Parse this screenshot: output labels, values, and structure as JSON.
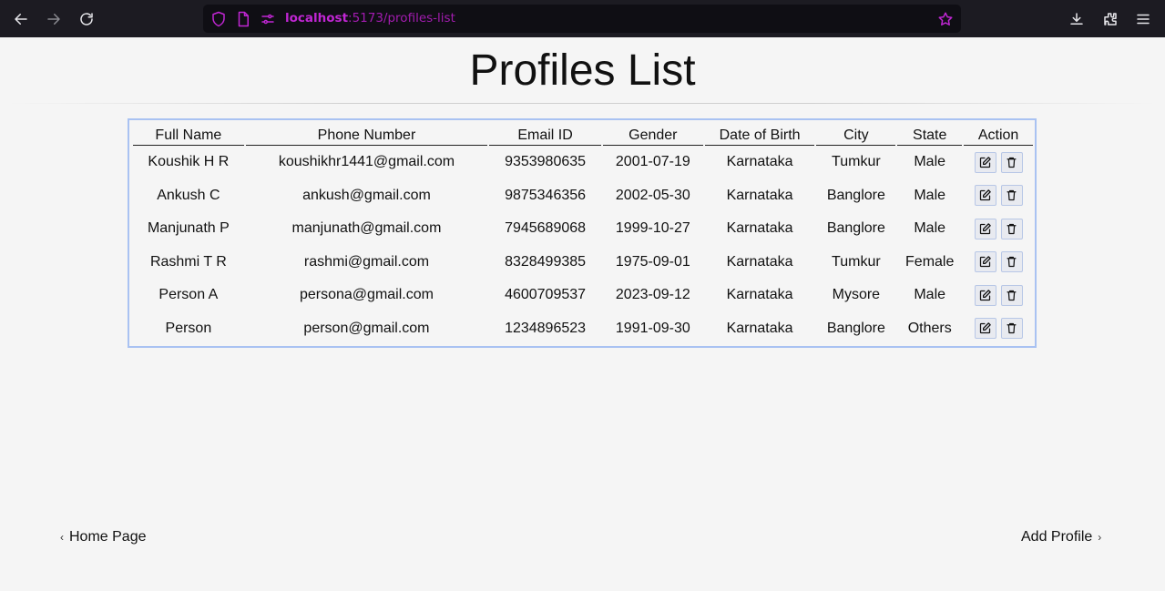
{
  "browser": {
    "url_host": "localhost",
    "url_path": ":5173/profiles-list"
  },
  "page": {
    "title": "Profiles List"
  },
  "table": {
    "headers": [
      "Full Name",
      "Phone Number",
      "Email ID",
      "Gender",
      "Date of Birth",
      "City",
      "State",
      "Action"
    ],
    "rows": [
      [
        "Koushik H R",
        "koushikhr1441@gmail.com",
        "9353980635",
        "2001-07-19",
        "Karnataka",
        "Tumkur",
        "Male"
      ],
      [
        "Ankush C",
        "ankush@gmail.com",
        "9875346356",
        "2002-05-30",
        "Karnataka",
        "Banglore",
        "Male"
      ],
      [
        "Manjunath P",
        "manjunath@gmail.com",
        "7945689068",
        "1999-10-27",
        "Karnataka",
        "Banglore",
        "Male"
      ],
      [
        "Rashmi T R",
        "rashmi@gmail.com",
        "8328499385",
        "1975-09-01",
        "Karnataka",
        "Tumkur",
        "Female"
      ],
      [
        "Person A",
        "persona@gmail.com",
        "4600709537",
        "2023-09-12",
        "Karnataka",
        "Mysore",
        "Male"
      ],
      [
        "Person",
        "person@gmail.com",
        "1234896523",
        "1991-09-30",
        "Karnataka",
        "Banglore",
        "Others"
      ]
    ]
  },
  "nav": {
    "home_label": "Home Page",
    "add_label": "Add Profile"
  },
  "icons": {
    "edit": "edit-icon",
    "delete": "trash-icon"
  }
}
